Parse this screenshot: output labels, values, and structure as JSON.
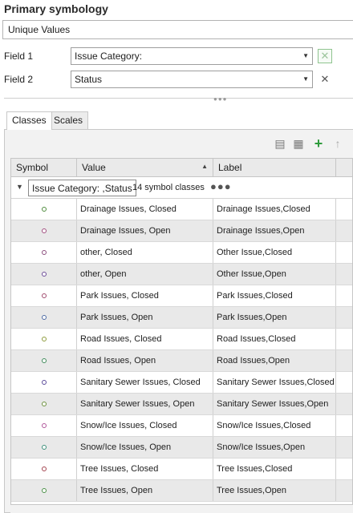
{
  "panel": {
    "title": "Primary symbology",
    "renderer": "Unique Values"
  },
  "fields": {
    "field1_label": "Field 1",
    "field1_value": "Issue Category:",
    "field2_label": "Field 2",
    "field2_value": "Status"
  },
  "tabs": [
    {
      "label": "Classes",
      "active": true
    },
    {
      "label": "Scales",
      "active": false
    }
  ],
  "toolbar": {
    "icons": [
      "table-view-icon",
      "import-symbology-icon",
      "add-class-icon",
      "move-up-icon"
    ]
  },
  "grid": {
    "columns": [
      "Symbol",
      "Value",
      "Label"
    ],
    "group": {
      "field_name": "Issue Category: ,Status",
      "count_text": "14 symbol classes",
      "more": "●●●"
    },
    "rows": [
      {
        "value": "Drainage Issues, Closed",
        "label": "Drainage Issues,Closed",
        "color": "#4f8c3d"
      },
      {
        "value": "Drainage Issues, Open",
        "label": "Drainage Issues,Open",
        "color": "#a04d7e"
      },
      {
        "value": "other, Closed",
        "label": "Other Issue,Closed",
        "color": "#8b4e7d"
      },
      {
        "value": "other, Open",
        "label": "Other Issue,Open",
        "color": "#6a4a96"
      },
      {
        "value": "Park Issues, Closed",
        "label": "Park Issues,Closed",
        "color": "#a04a6e"
      },
      {
        "value": "Park Issues, Open",
        "label": "Park Issues,Open",
        "color": "#4d6aa3"
      },
      {
        "value": "Road Issues, Closed",
        "label": "Road Issues,Closed",
        "color": "#8e9b3c"
      },
      {
        "value": "Road Issues, Open",
        "label": "Road Issues,Open",
        "color": "#3f8a5a"
      },
      {
        "value": "Sanitary Sewer Issues, Closed",
        "label": "Sanitary Sewer Issues,Closed",
        "color": "#5b4a9a"
      },
      {
        "value": "Sanitary Sewer Issues, Open",
        "label": "Sanitary Sewer Issues,Open",
        "color": "#6b8f3d"
      },
      {
        "value": "Snow/Ice Issues, Closed",
        "label": "Snow/Ice Issues,Closed",
        "color": "#b0569a"
      },
      {
        "value": "Snow/Ice Issues, Open",
        "label": "Snow/Ice Issues,Open",
        "color": "#3d8f7a"
      },
      {
        "value": "Tree Issues, Closed",
        "label": "Tree Issues,Closed",
        "color": "#a3434f"
      },
      {
        "value": "Tree Issues, Open",
        "label": "Tree Issues,Open",
        "color": "#4a8f46"
      }
    ]
  }
}
